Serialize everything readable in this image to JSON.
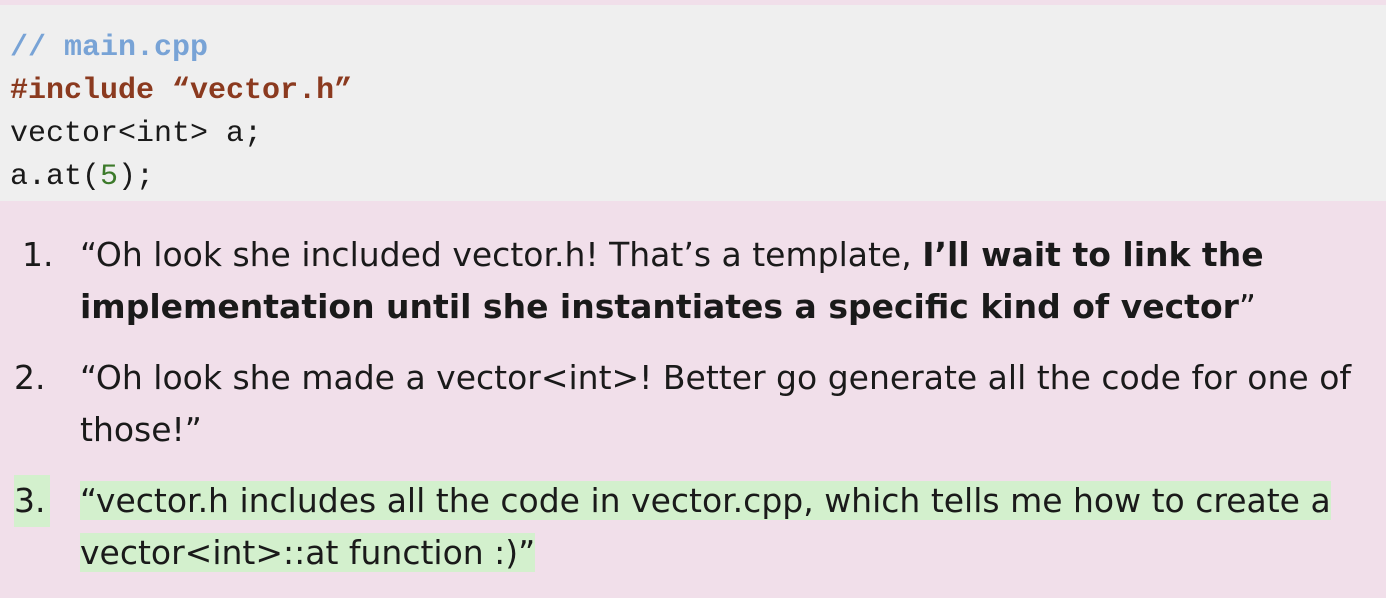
{
  "code": {
    "comment": "// main.cpp",
    "include_directive": "#include",
    "include_file": "“vector.h”",
    "line3": "vector<int> a;",
    "line4_prefix": "a.at(",
    "line4_arg": "5",
    "line4_suffix": ");"
  },
  "list": {
    "items": [
      {
        "marker": "1.",
        "text_plain": "“Oh look she included vector.h! That’s a template, ",
        "text_bold": "I’ll wait to link the implementation until she instantiates a specific kind of vector",
        "text_end": "”"
      },
      {
        "marker": "2.",
        "text": "“Oh look she made a vector<int>! Better go generate all the code for one of those!”"
      },
      {
        "marker": "3.",
        "text": "“vector.h includes all the code in vector.cpp, which tells me how to create a vector<int>::at function :)”",
        "highlight_color": "#d3f0cd"
      }
    ]
  },
  "colors": {
    "page_background": "#f1dfea",
    "code_background": "#efefef",
    "comment": "#78a3d6",
    "preprocessor": "#8b3a1f",
    "number": "#3c7a2a"
  }
}
